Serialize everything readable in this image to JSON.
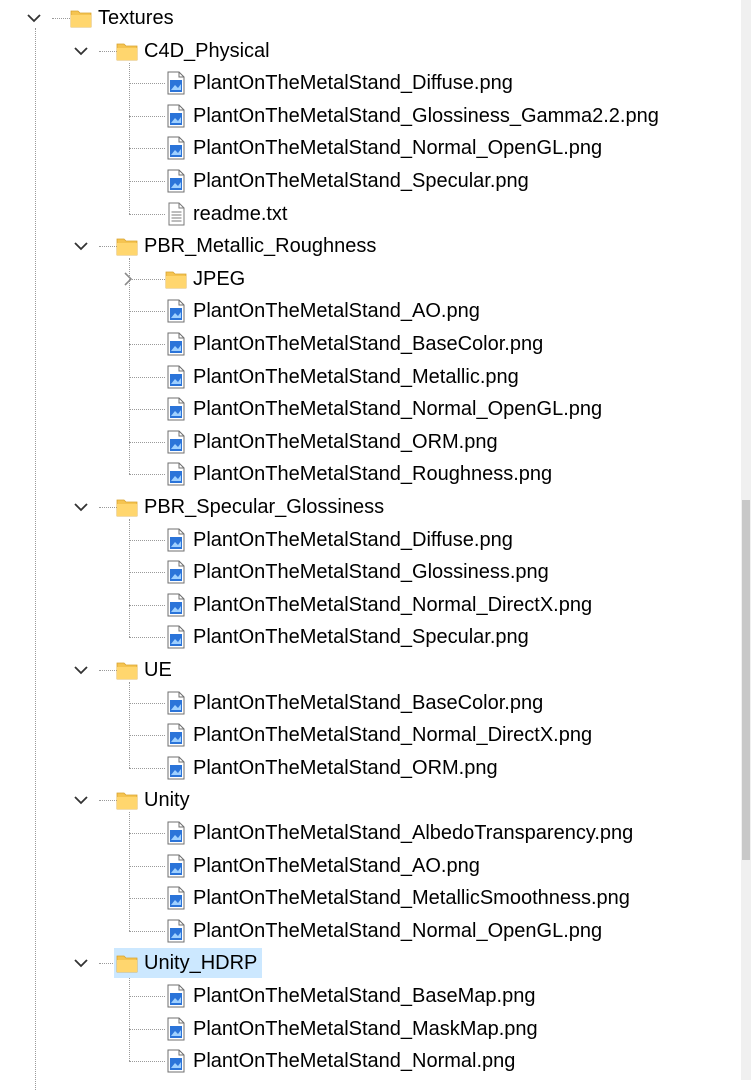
{
  "tree": [
    {
      "label": "Textures",
      "type": "folder",
      "depth": 0,
      "expanded": true,
      "selected": false
    },
    {
      "label": "C4D_Physical",
      "type": "folder",
      "depth": 1,
      "expanded": true,
      "selected": false
    },
    {
      "label": "PlantOnTheMetalStand_Diffuse.png",
      "type": "png",
      "depth": 2
    },
    {
      "label": "PlantOnTheMetalStand_Glossiness_Gamma2.2.png",
      "type": "png",
      "depth": 2
    },
    {
      "label": "PlantOnTheMetalStand_Normal_OpenGL.png",
      "type": "png",
      "depth": 2
    },
    {
      "label": "PlantOnTheMetalStand_Specular.png",
      "type": "png",
      "depth": 2
    },
    {
      "label": "readme.txt",
      "type": "txt",
      "depth": 2
    },
    {
      "label": "PBR_Metallic_Roughness",
      "type": "folder",
      "depth": 1,
      "expanded": true,
      "selected": false
    },
    {
      "label": "JPEG",
      "type": "folder",
      "depth": 2,
      "expanded": false,
      "selected": false
    },
    {
      "label": "PlantOnTheMetalStand_AO.png",
      "type": "png",
      "depth": 2
    },
    {
      "label": "PlantOnTheMetalStand_BaseColor.png",
      "type": "png",
      "depth": 2
    },
    {
      "label": "PlantOnTheMetalStand_Metallic.png",
      "type": "png",
      "depth": 2
    },
    {
      "label": "PlantOnTheMetalStand_Normal_OpenGL.png",
      "type": "png",
      "depth": 2
    },
    {
      "label": "PlantOnTheMetalStand_ORM.png",
      "type": "png",
      "depth": 2
    },
    {
      "label": "PlantOnTheMetalStand_Roughness.png",
      "type": "png",
      "depth": 2
    },
    {
      "label": "PBR_Specular_Glossiness",
      "type": "folder",
      "depth": 1,
      "expanded": true,
      "selected": false
    },
    {
      "label": "PlantOnTheMetalStand_Diffuse.png",
      "type": "png",
      "depth": 2
    },
    {
      "label": "PlantOnTheMetalStand_Glossiness.png",
      "type": "png",
      "depth": 2
    },
    {
      "label": "PlantOnTheMetalStand_Normal_DirectX.png",
      "type": "png",
      "depth": 2
    },
    {
      "label": "PlantOnTheMetalStand_Specular.png",
      "type": "png",
      "depth": 2
    },
    {
      "label": "UE",
      "type": "folder",
      "depth": 1,
      "expanded": true,
      "selected": false
    },
    {
      "label": "PlantOnTheMetalStand_BaseColor.png",
      "type": "png",
      "depth": 2
    },
    {
      "label": "PlantOnTheMetalStand_Normal_DirectX.png",
      "type": "png",
      "depth": 2
    },
    {
      "label": "PlantOnTheMetalStand_ORM.png",
      "type": "png",
      "depth": 2
    },
    {
      "label": "Unity",
      "type": "folder",
      "depth": 1,
      "expanded": true,
      "selected": false
    },
    {
      "label": "PlantOnTheMetalStand_AlbedoTransparency.png",
      "type": "png",
      "depth": 2
    },
    {
      "label": "PlantOnTheMetalStand_AO.png",
      "type": "png",
      "depth": 2
    },
    {
      "label": "PlantOnTheMetalStand_MetallicSmoothness.png",
      "type": "png",
      "depth": 2
    },
    {
      "label": "PlantOnTheMetalStand_Normal_OpenGL.png",
      "type": "png",
      "depth": 2
    },
    {
      "label": "Unity_HDRP",
      "type": "folder",
      "depth": 1,
      "expanded": true,
      "selected": true
    },
    {
      "label": "PlantOnTheMetalStand_BaseMap.png",
      "type": "png",
      "depth": 2
    },
    {
      "label": "PlantOnTheMetalStand_MaskMap.png",
      "type": "png",
      "depth": 2
    },
    {
      "label": "PlantOnTheMetalStand_Normal.png",
      "type": "png",
      "depth": 2
    }
  ],
  "colors": {
    "selection": "#cce8ff",
    "folder": "#f5c451",
    "image_icon_blue": "#2b74d9",
    "tree_lines": "#9a9a9a"
  },
  "icons": {
    "folder": "folder-icon",
    "png": "image-file-icon",
    "txt": "text-file-icon",
    "expanded": "chevron-down-icon",
    "collapsed": "chevron-right-icon"
  }
}
